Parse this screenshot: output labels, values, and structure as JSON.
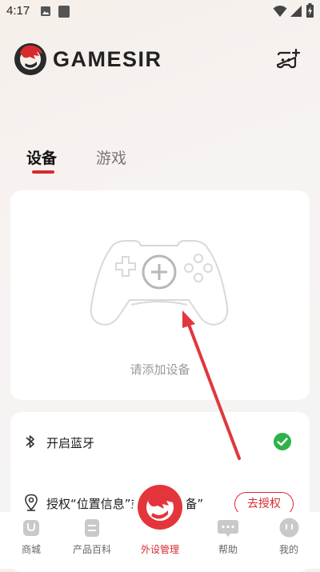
{
  "status_bar": {
    "time": "4:17"
  },
  "brand": {
    "name": "GAMESIR",
    "accent": "#d8292f"
  },
  "header": {
    "add_device_icon": "add-controller-icon"
  },
  "tabs": [
    {
      "label": "设备",
      "active": true
    },
    {
      "label": "游戏",
      "active": false
    }
  ],
  "device_card": {
    "placeholder_label": "请添加设备",
    "icon": "gamepad-add-icon"
  },
  "settings": {
    "bluetooth": {
      "label": "开启蓝牙",
      "status": "enabled"
    },
    "location": {
      "label": "授权“位置信息”或“附近设备”",
      "button": "去授权"
    }
  },
  "bottom_nav": [
    {
      "label": "商城",
      "icon": "store-icon",
      "active": false
    },
    {
      "label": "产品百科",
      "icon": "encyclopedia-icon",
      "active": false
    },
    {
      "label": "外设管理",
      "icon": "gamesir-logo-icon",
      "active": true
    },
    {
      "label": "帮助",
      "icon": "chat-icon",
      "active": false
    },
    {
      "label": "我的",
      "icon": "profile-icon",
      "active": false
    }
  ]
}
